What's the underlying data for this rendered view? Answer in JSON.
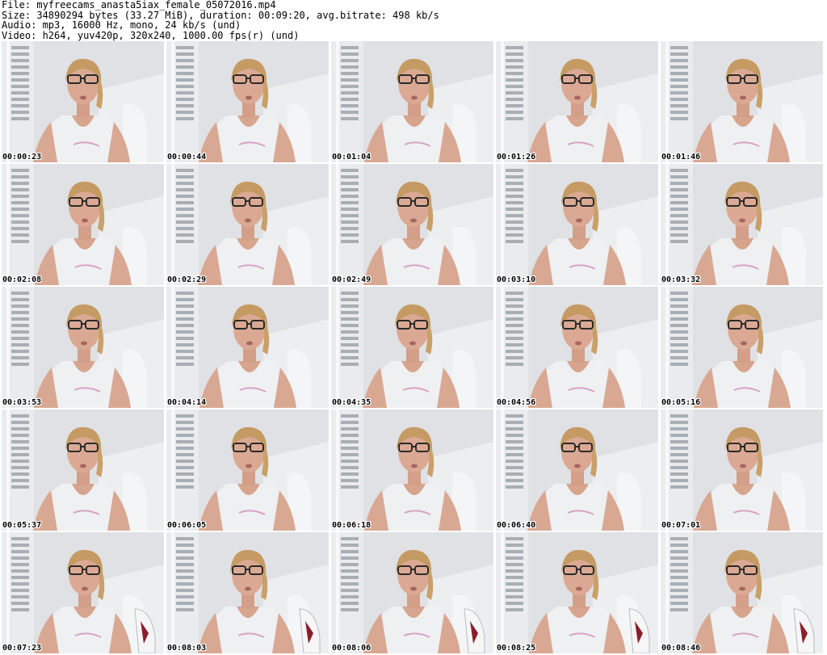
{
  "header": {
    "file_line": "File: myfreecams_anasta5iax_female_05072016.mp4",
    "size_line": "Size: 34890294 bytes (33.27 MiB), duration: 00:09:20, avg.bitrate: 498 kb/s",
    "audio_line": "Audio: mp3, 16000 Hz, mono, 24 kb/s (und)",
    "video_line": "Video: h264, yuv420p, 320x240, 1000.00 fps(r) (und)"
  },
  "thumbnails": [
    {
      "timestamp": "00:00:23"
    },
    {
      "timestamp": "00:00:44"
    },
    {
      "timestamp": "00:01:04"
    },
    {
      "timestamp": "00:01:26"
    },
    {
      "timestamp": "00:01:46"
    },
    {
      "timestamp": "00:02:08"
    },
    {
      "timestamp": "00:02:29"
    },
    {
      "timestamp": "00:02:49"
    },
    {
      "timestamp": "00:03:10"
    },
    {
      "timestamp": "00:03:32"
    },
    {
      "timestamp": "00:03:53"
    },
    {
      "timestamp": "00:04:14"
    },
    {
      "timestamp": "00:04:35"
    },
    {
      "timestamp": "00:04:56"
    },
    {
      "timestamp": "00:05:16"
    },
    {
      "timestamp": "00:05:37"
    },
    {
      "timestamp": "00:06:05"
    },
    {
      "timestamp": "00:06:18"
    },
    {
      "timestamp": "00:06:40"
    },
    {
      "timestamp": "00:07:01"
    },
    {
      "timestamp": "00:07:23"
    },
    {
      "timestamp": "00:08:03"
    },
    {
      "timestamp": "00:08:06"
    },
    {
      "timestamp": "00:08:25"
    },
    {
      "timestamp": "00:08:46"
    }
  ]
}
